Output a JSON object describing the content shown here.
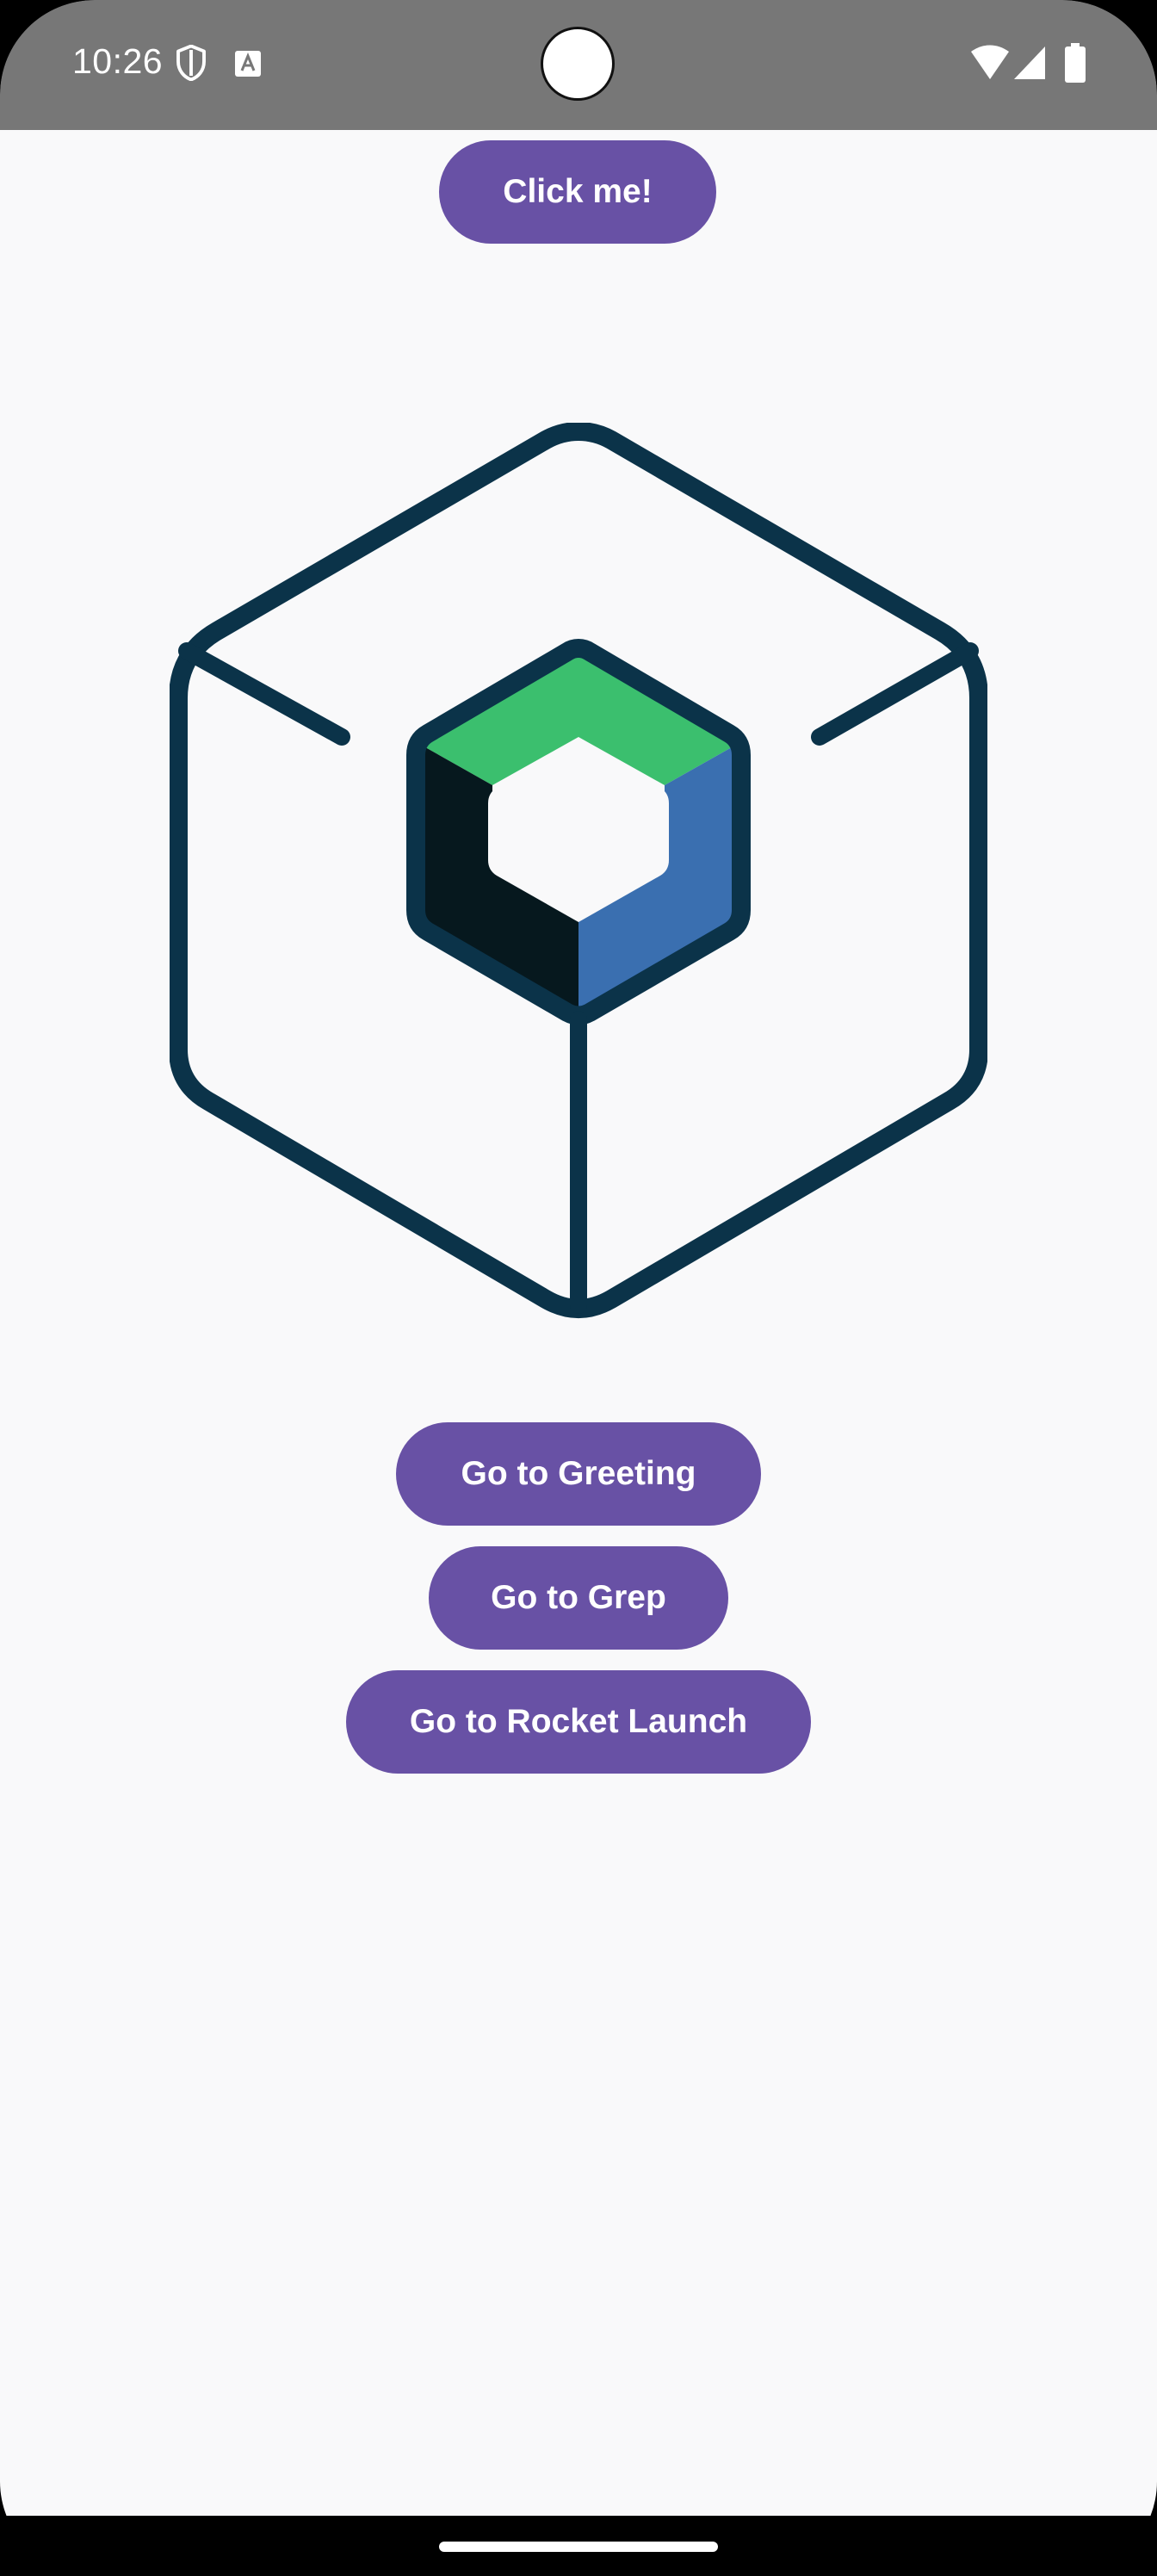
{
  "status_bar": {
    "time": "10:26",
    "left_icons": [
      "shield-icon",
      "a-notification-icon"
    ],
    "right_icons": [
      "wifi-icon",
      "cell-signal-icon",
      "battery-icon"
    ]
  },
  "buttons": {
    "click_me": "Click me!",
    "go_to_greeting": "Go to Greeting",
    "go_to_grep": "Go to Grep",
    "go_to_rocket_launch": "Go to Rocket Launch"
  },
  "logo": {
    "icon": "compose-multiplatform-logo-icon"
  },
  "colors": {
    "status_bar_bg": "#777777",
    "app_bg": "#f9f9fa",
    "button_bg": "#6851a5",
    "button_text": "#ffffff",
    "logo_outline": "#0b3349",
    "logo_green": "#3bbf6e",
    "logo_blue": "#3a6fb0",
    "logo_dark": "#06181e"
  }
}
